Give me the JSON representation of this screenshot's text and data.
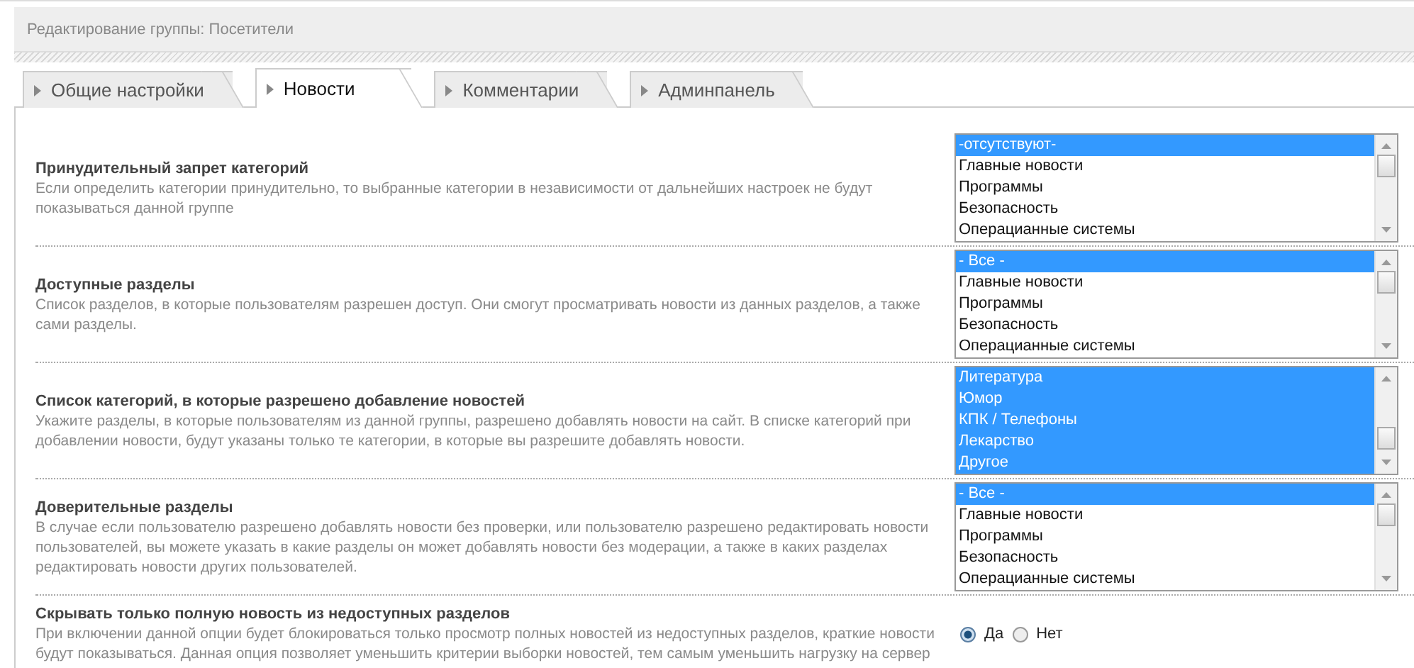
{
  "header": {
    "title": "Редактирование группы: Посетители"
  },
  "tabs": [
    {
      "label": "Общие настройки",
      "selected": false
    },
    {
      "label": "Новости",
      "selected": true
    },
    {
      "label": "Комментарии",
      "selected": false
    },
    {
      "label": "Админпанель",
      "selected": false
    }
  ],
  "sections": [
    {
      "kind": "select",
      "title": "Принудительный запрет категорий",
      "description": "Если определить категории принудительно, то выбранные категории в независимости от дальнейших настроек не будут показываться данной группе",
      "options": [
        {
          "label": "-отсутствуют-",
          "selected": true
        },
        {
          "label": "Главные новости",
          "selected": false
        },
        {
          "label": "Программы",
          "selected": false
        },
        {
          "label": "Безопасность",
          "selected": false
        },
        {
          "label": "Операцианные системы",
          "selected": false
        }
      ]
    },
    {
      "kind": "select",
      "title": "Доступные разделы",
      "description": "Список разделов, в которые пользователям разрешен доступ. Они смогут просматривать новости из данных разделов, а также сами разделы.",
      "options": [
        {
          "label": "- Все -",
          "selected": true
        },
        {
          "label": "Главные новости",
          "selected": false
        },
        {
          "label": "Программы",
          "selected": false
        },
        {
          "label": "Безопасность",
          "selected": false
        },
        {
          "label": "Операцианные системы",
          "selected": false
        }
      ]
    },
    {
      "kind": "select",
      "title": "Список категорий, в которые разрешено добавление новостей",
      "description": "Укажите разделы, в которые пользователям из данной группы, разрешено добавлять новости на сайт. В списке категорий при добавлении новости, будут указаны только те категории, в которые вы разрешите добавлять новости.",
      "options": [
        {
          "label": "Литература",
          "selected": true
        },
        {
          "label": "Юмор",
          "selected": true
        },
        {
          "label": "КПК / Телефоны",
          "selected": true
        },
        {
          "label": "Лекарство",
          "selected": true
        },
        {
          "label": "Другое",
          "selected": true
        }
      ]
    },
    {
      "kind": "select",
      "title": "Доверительные разделы",
      "description": "В случае если пользователю разрешено добавлять новости без проверки, или пользователю разрешено редактировать новости пользователей, вы можете указать в какие разделы он может добавлять новости без модерации, а также в каких разделах редактировать новости других пользователей.",
      "options": [
        {
          "label": "- Все -",
          "selected": true
        },
        {
          "label": "Главные новости",
          "selected": false
        },
        {
          "label": "Программы",
          "selected": false
        },
        {
          "label": "Безопасность",
          "selected": false
        },
        {
          "label": "Операцианные системы",
          "selected": false
        }
      ]
    },
    {
      "kind": "radio",
      "title": "Скрывать только полную новость из недоступных разделов",
      "description": "При включении данной опции будет блокироваться только просмотр полных новостей из недоступных разделов, краткие новости будут показываться. Данная опция позволяет уменьшить критерии выборки новостей, тем самым уменьшить нагрузку на сервер",
      "options": [
        {
          "label": "Да",
          "selected": true
        },
        {
          "label": "Нет",
          "selected": false
        }
      ]
    }
  ]
}
